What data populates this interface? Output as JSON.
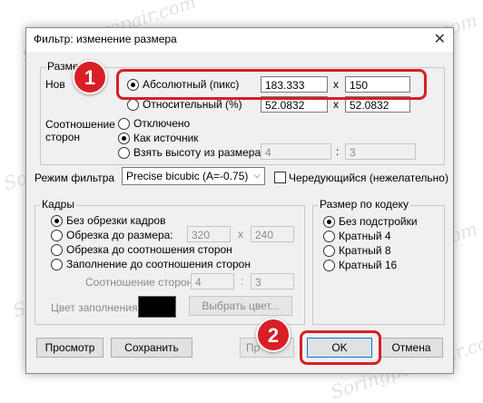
{
  "window": {
    "title": "Фильтр: изменение размера",
    "close_glyph": "✕"
  },
  "size_group": {
    "label": "Разме",
    "new_label": "Нов",
    "absolute": {
      "label": "Абсолютный (пикс)",
      "width": "183.333",
      "height": "150",
      "selected": true
    },
    "relative": {
      "label": "Относительный (%)",
      "width": "52.0832",
      "height": "52.0832",
      "selected": false
    },
    "x_sep": "x",
    "aspect_label_1": "Соотношение",
    "aspect_label_2": "сторон",
    "aspect_options": [
      "Отключено",
      "Как источник",
      "Взять высоту из размера:"
    ],
    "aspect_selected": 1,
    "aspect_w": "4",
    "aspect_h": "3",
    "colon": ":"
  },
  "filter": {
    "label": "Режим фильтра",
    "value": "Precise bicubic (A=-0.75)",
    "interlaced_label": "Чередующийся (нежелательно)"
  },
  "frames": {
    "label": "Кадры",
    "options": [
      "Без обрезки кадров",
      "Обрезка до размера:",
      "Обрезка до соотношения сторон",
      "Заполнение до соотношения сторон"
    ],
    "selected": 0,
    "crop_w": "320",
    "crop_h": "240",
    "ratio_label": "Соотношение сторон",
    "ratio_w": "4",
    "ratio_h": "3",
    "fill_label": "Цвет заполнения",
    "fill_color": "#000000",
    "choose_color": "Выбрать цвет..."
  },
  "codec": {
    "label": "Размер по кодеку",
    "options": [
      "Без подстройки",
      "Кратный 4",
      "Кратный 8",
      "Кратный 16"
    ],
    "selected": 0
  },
  "buttons": {
    "preview": "Просмотр",
    "save": "Сохранить",
    "apply": "Пр",
    "ok": "OK",
    "cancel": "Отмена"
  },
  "annotations": {
    "badge1": "1",
    "badge2": "2",
    "accent": "#d71f25"
  },
  "watermark": "Soringpcrepair.com"
}
